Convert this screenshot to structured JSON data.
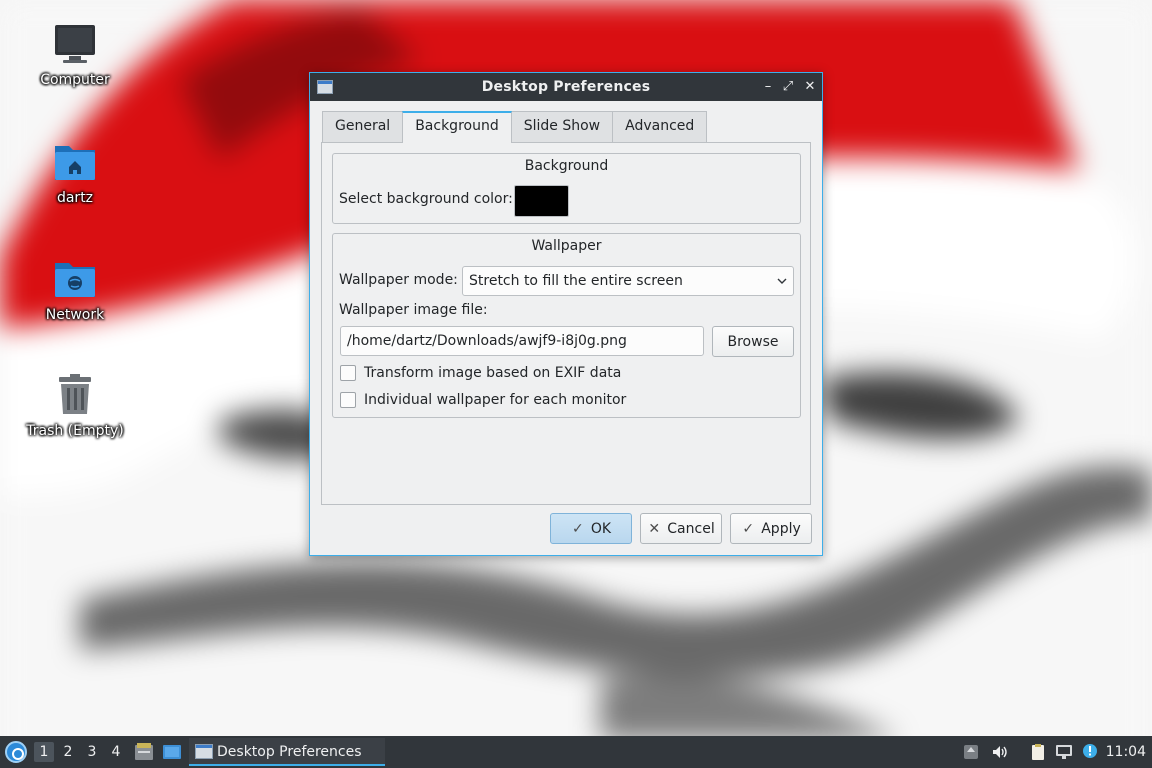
{
  "desktop": {
    "icons": [
      {
        "label": "Computer",
        "icon": "computer-icon"
      },
      {
        "label": "dartz",
        "icon": "home-folder-icon"
      },
      {
        "label": "Network",
        "icon": "network-folder-icon"
      },
      {
        "label": "Trash (Empty)",
        "icon": "trash-icon"
      }
    ]
  },
  "dialog": {
    "title": "Desktop Preferences",
    "window_buttons": {
      "minimize": "–",
      "maximize": "⤢",
      "close": "✕"
    },
    "tabs": [
      {
        "label": "General",
        "active": false
      },
      {
        "label": "Background",
        "active": true
      },
      {
        "label": "Slide Show",
        "active": false
      },
      {
        "label": "Advanced",
        "active": false
      }
    ],
    "background_group": {
      "title": "Background",
      "color_label": "Select background color:",
      "color_value": "#000000"
    },
    "wallpaper_group": {
      "title": "Wallpaper",
      "mode_label": "Wallpaper mode:",
      "mode_value": "Stretch to fill the entire screen",
      "file_label": "Wallpaper image file:",
      "file_value": "/home/dartz/Downloads/awjf9-i8j0g.png",
      "browse_label": "Browse",
      "exif_label": "Transform image based on EXIF data",
      "exif_checked": false,
      "per_monitor_label": "Individual wallpaper for each monitor",
      "per_monitor_checked": false
    },
    "buttons": {
      "ok": "OK",
      "cancel": "Cancel",
      "apply": "Apply"
    }
  },
  "taskbar": {
    "workspaces": [
      "1",
      "2",
      "3",
      "4"
    ],
    "active_workspace": "1",
    "task_label": "Desktop Preferences",
    "clock": "11:04",
    "tray_icons": [
      "updates-icon",
      "volume-icon",
      "clipboard-icon",
      "network-status-icon",
      "notification-icon"
    ]
  },
  "colors": {
    "accent": "#3daee9",
    "titlebar": "#31363b",
    "dialog_bg": "#eff0f1",
    "panel": "#31363b"
  }
}
